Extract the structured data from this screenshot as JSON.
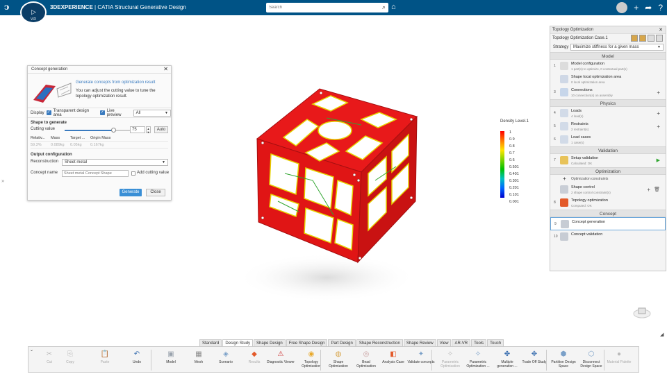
{
  "app": {
    "brand_bold": "3DEXPERIENCE",
    "brand_rest": " | CATIA Structural Generative Design",
    "compass_label": "V.R",
    "search_placeholder": "Search"
  },
  "dialog": {
    "title": "Concept generation",
    "hero_link": "Generate concepts from optimization result",
    "hero_desc": "You can adjust the cutting value to tune the topology optimization result.",
    "display_label": "Display",
    "transparent_label": "Transparent design area",
    "live_preview_label": "Live preview",
    "display_select": "All",
    "shape_section": "Shape to generate",
    "cutting_label": "Cutting value",
    "cutting_value": "75",
    "cutting_fraction": 0.75,
    "auto_label": "Auto",
    "table_headers": [
      "Relativ...",
      "Mass",
      "Target ...",
      "Origin Mass"
    ],
    "table_values": [
      "59.3%",
      "0.089kg",
      "0.05kg",
      "0.167kg"
    ],
    "output_section": "Output configuration",
    "reconstruction_label": "Reconstruction",
    "reconstruction_value": "Sheet metal",
    "concept_name_label": "Concept name",
    "concept_name_placeholder": "Sheet metal Concept Shape",
    "add_cutting_label": "Add cutting value",
    "generate_btn": "Generate",
    "close_btn": "Close"
  },
  "legend": {
    "title": "Density Level.1",
    "values": [
      "1",
      "0.9",
      "0.8",
      "0.7",
      "0.6",
      "0.501",
      "0.401",
      "0.301",
      "0.201",
      "0.101",
      "0.001"
    ]
  },
  "panel": {
    "title": "Topology Optimization",
    "case_name": "Topology Optimization Case.1",
    "strategy_label": "Strategy",
    "strategy_value": "Maximize stiffness for a given mass",
    "sections": {
      "model": "Model",
      "physics": "Physics",
      "validation": "Validation",
      "optimization": "Optimization",
      "concept": "Concept"
    },
    "model_items": [
      {
        "num": "1",
        "title": "Model configuration",
        "sub": "1 part(s) to optimize, 0 contextual part(s)"
      },
      {
        "num": "",
        "title": "Shape local optimization area",
        "sub": "0 local optimization area"
      },
      {
        "num": "3",
        "title": "Connections",
        "sub": "10 connection(s) on assembly"
      }
    ],
    "physics_items": [
      {
        "num": "4",
        "title": "Loads",
        "sub": "4 load(s)"
      },
      {
        "num": "5",
        "title": "Restraints",
        "sub": "2 restraint(s)"
      },
      {
        "num": "6",
        "title": "Load cases",
        "sub": "1 case(s)"
      }
    ],
    "validation_items": [
      {
        "num": "7",
        "title": "Setup validation",
        "sub": "Calculated: OK"
      }
    ],
    "optimization_add": "Optimization constraints",
    "optimization_items": [
      {
        "num": "",
        "title": "Shape control",
        "sub": "2 shape control constraint(s)"
      },
      {
        "num": "8",
        "title": "Topology optimization",
        "sub": "Computed: OK"
      }
    ],
    "concept_items": [
      {
        "num": "9",
        "title": "Concept generation",
        "sub": ""
      },
      {
        "num": "10",
        "title": "Concept validation",
        "sub": ""
      }
    ]
  },
  "tabs": [
    "Standard",
    "Design Study",
    "Shape Design",
    "Free Shape Design",
    "Part Design",
    "Shape Reconstruction",
    "Shape Review",
    "View",
    "AR-VR",
    "Tools",
    "Touch"
  ],
  "active_tab": "Design Study",
  "toolbar": [
    {
      "label": "Cut",
      "disabled": true,
      "icon": "scissors-icon",
      "glyph": "✂"
    },
    {
      "label": "Copy",
      "disabled": true,
      "icon": "copy-icon",
      "glyph": "⎘"
    },
    {
      "label": "Paste",
      "disabled": true,
      "icon": "paste-icon",
      "glyph": "📋"
    },
    {
      "label": "Undo",
      "disabled": false,
      "icon": "undo-icon",
      "glyph": "↶"
    },
    {
      "label": "Model",
      "disabled": false,
      "icon": "model-icon",
      "glyph": "▣"
    },
    {
      "label": "Mesh",
      "disabled": false,
      "icon": "mesh-icon",
      "glyph": "▦"
    },
    {
      "label": "Scenario",
      "disabled": false,
      "icon": "scenario-icon",
      "glyph": "◈"
    },
    {
      "label": "Results",
      "disabled": true,
      "icon": "results-icon",
      "glyph": "◆"
    },
    {
      "label": "Diagnostic Viewer",
      "disabled": false,
      "icon": "diagnostic-icon",
      "glyph": "⚠"
    },
    {
      "label": "Topology Optimization",
      "disabled": false,
      "icon": "topology-icon",
      "glyph": "◉"
    },
    {
      "label": "Shape Optimization",
      "disabled": false,
      "icon": "shape-opt-icon",
      "glyph": "◍"
    },
    {
      "label": "Bead Optimization",
      "disabled": false,
      "icon": "bead-icon",
      "glyph": "◎"
    },
    {
      "label": "Analysis Case",
      "disabled": false,
      "icon": "analysis-icon",
      "glyph": "◧"
    },
    {
      "label": "Validate concepts",
      "disabled": false,
      "icon": "validate-icon",
      "glyph": "✦"
    },
    {
      "label": "Parametric Optimization",
      "disabled": true,
      "icon": "param-opt-icon",
      "glyph": "✧"
    },
    {
      "label": "Parametric Optimization ...",
      "disabled": false,
      "icon": "param-opt2-icon",
      "glyph": "✧"
    },
    {
      "label": "Multiple generation ...",
      "disabled": false,
      "icon": "multi-gen-icon",
      "glyph": "✤"
    },
    {
      "label": "Trade Off Study",
      "disabled": false,
      "icon": "tradeoff-icon",
      "glyph": "✥"
    },
    {
      "label": "Partition Design Space",
      "disabled": false,
      "icon": "partition-icon",
      "glyph": "⬢"
    },
    {
      "label": "Disconnect Design Space",
      "disabled": false,
      "icon": "disconnect-icon",
      "glyph": "⬡"
    },
    {
      "label": "Material Palette",
      "disabled": true,
      "icon": "material-icon",
      "glyph": "●"
    }
  ],
  "colors": {
    "topbar": "#005386",
    "accent": "#3a8fd6",
    "part_red": "#e8191a",
    "part_yellow": "#e6d400",
    "part_green": "#2fa52f"
  }
}
